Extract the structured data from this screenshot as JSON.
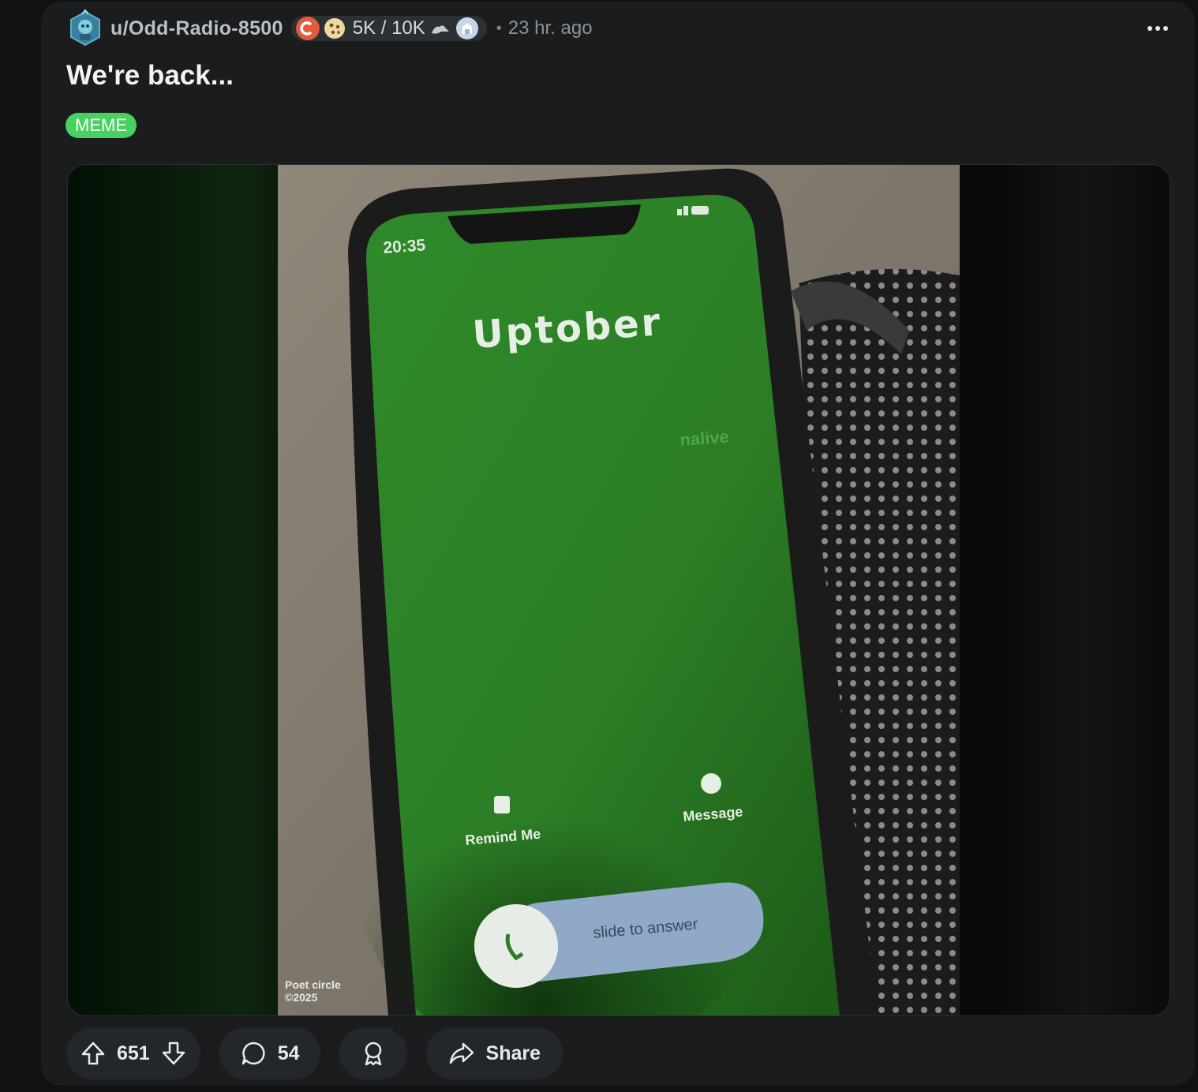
{
  "post": {
    "author": "u/Odd-Radio-8500",
    "karma_progress": "5K / 10K",
    "separator": "•",
    "time_ago": "23 hr. ago",
    "title": "We're back...",
    "flair": "MEME"
  },
  "media": {
    "clock": "20:35",
    "caller_name": "Uptober",
    "watermark": "nalive",
    "remind_label": "Remind Me",
    "message_label": "Message",
    "slide_label": "slide to answer",
    "credit_line1": "Poet circle",
    "credit_line2": "©2025"
  },
  "actions": {
    "upvotes": "651",
    "comments": "54",
    "share_label": "Share"
  },
  "colors": {
    "flair_bg": "#46d160",
    "card_bg": "#1a1c1e",
    "pill_bg": "#23262a",
    "phone_screen": "#2f8a2a"
  },
  "icons": [
    "avatar-icon",
    "c-badge-icon",
    "cookie-badge-icon",
    "rank-badge-icon",
    "more-options-icon",
    "upvote-icon",
    "downvote-icon",
    "comment-icon",
    "award-icon",
    "share-icon"
  ]
}
